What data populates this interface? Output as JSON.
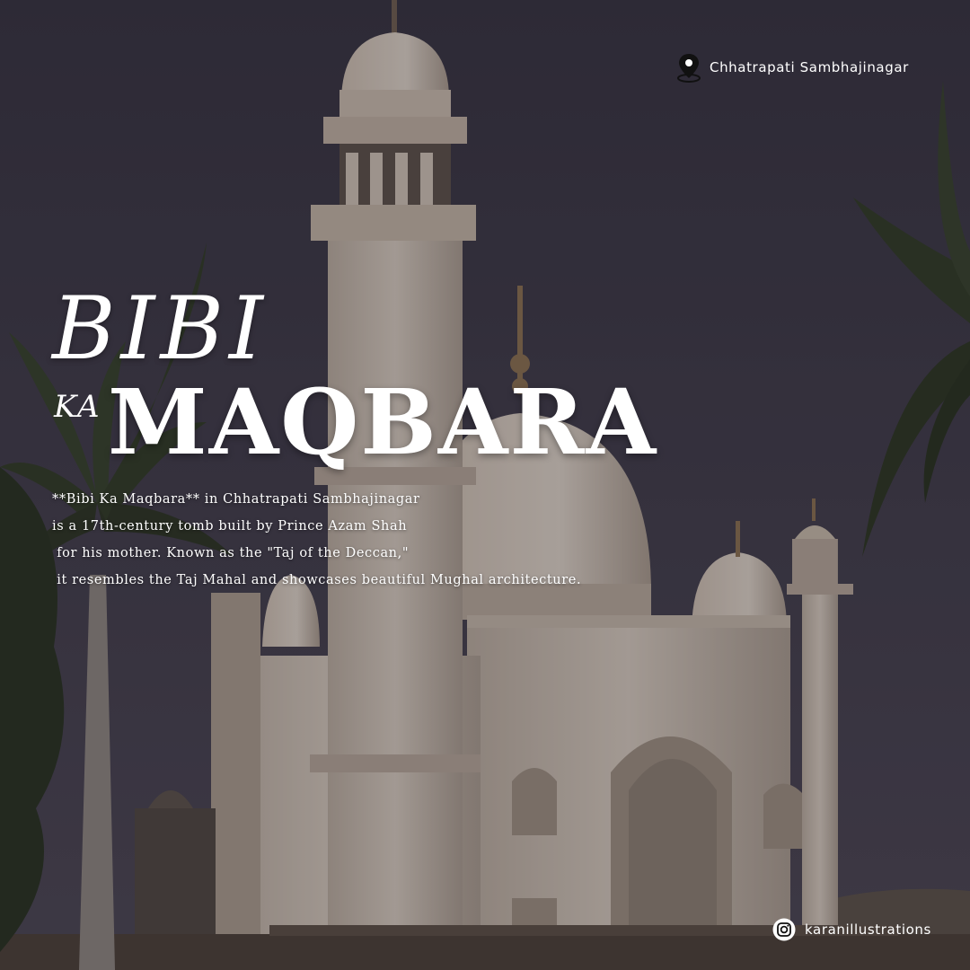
{
  "location": {
    "icon": "map-pin-icon",
    "text": "Chhatrapati Sambhajinagar"
  },
  "title": {
    "line1": "BIBI",
    "prefix": "KA",
    "main": "MAQBARA"
  },
  "description": {
    "lines": [
      "**Bibi Ka Maqbara** in Chhatrapati Sambhajinagar",
      "is a 17th-century tomb built by Prince Azam Shah",
      " for his mother. Known as the \"Taj of the Deccan,\"",
      " it resembles the Taj Mahal and showcases beautiful Mughal architecture."
    ]
  },
  "social": {
    "icon": "instagram-icon",
    "handle": "karanillustrations"
  },
  "colors": {
    "sky": "#3b3945",
    "marble": "#cfc3b6",
    "text": "#ffffff"
  }
}
